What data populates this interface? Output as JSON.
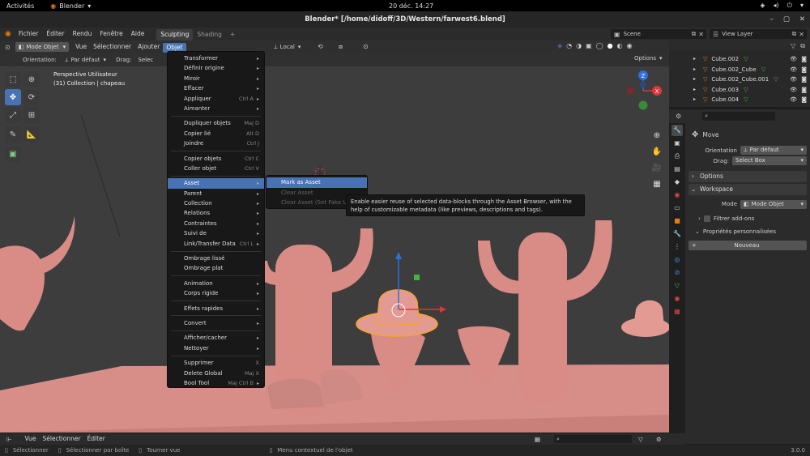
{
  "gnome": {
    "activities": "Activités",
    "app": "Blender",
    "clock": "20 déc.  14:27"
  },
  "window": {
    "title": "Blender* [/home/didoff/3D/Western/farwest6.blend]"
  },
  "topbar": {
    "menus": [
      "Fichier",
      "Éditer",
      "Rendu",
      "Fenêtre",
      "Aide"
    ],
    "workspaces": [
      "Sculpting",
      "Shading"
    ],
    "add_tab": "+",
    "scene": "Scene",
    "view_layer": "View Layer"
  },
  "viewport": {
    "mode": "Mode Objet",
    "menus": [
      "Vue",
      "Sélectionner",
      "Ajouter",
      "Objet"
    ],
    "transform": "Local",
    "orientation_label": "Orientation:",
    "orientation_value": "Par défaut",
    "drag_label": "Drag:",
    "drag_value": "Selec",
    "options": "Options",
    "overlay_title": "Perspective Utilisateur",
    "overlay_sub": "(31) Collection | chapeau",
    "gizmo_axes": [
      "X",
      "Y",
      "Z"
    ]
  },
  "object_menu": [
    {
      "label": "Transformer",
      "arrow": true
    },
    {
      "label": "Définir origine",
      "arrow": true
    },
    {
      "label": "Miroir",
      "arrow": true
    },
    {
      "label": "Effacer",
      "arrow": true
    },
    {
      "label": "Appliquer",
      "shortcut": "Ctrl A",
      "arrow": true
    },
    {
      "label": "Aimanter",
      "arrow": true
    },
    {
      "sep": true
    },
    {
      "label": "Dupliquer objets",
      "shortcut": "Maj D"
    },
    {
      "label": "Copier lié",
      "shortcut": "Alt D"
    },
    {
      "label": "Joindre",
      "shortcut": "Ctrl J"
    },
    {
      "sep": true
    },
    {
      "label": "Copier objets",
      "shortcut": "Ctrl C"
    },
    {
      "label": "Coller objet",
      "shortcut": "Ctrl V"
    },
    {
      "sep": true
    },
    {
      "label": "Asset",
      "arrow": true,
      "selected": true
    },
    {
      "label": "Parent",
      "arrow": true
    },
    {
      "label": "Collection",
      "arrow": true
    },
    {
      "label": "Relations",
      "arrow": true
    },
    {
      "label": "Contraintes",
      "arrow": true
    },
    {
      "label": "Suivi de",
      "arrow": true
    },
    {
      "label": "Link/Transfer Data",
      "shortcut": "Ctrl L",
      "arrow": true
    },
    {
      "sep": true
    },
    {
      "label": "Ombrage lissé"
    },
    {
      "label": "Ombrage plat"
    },
    {
      "sep": true
    },
    {
      "label": "Animation",
      "arrow": true
    },
    {
      "label": "Corps rigide",
      "arrow": true
    },
    {
      "sep": true
    },
    {
      "label": "Effets rapides",
      "arrow": true
    },
    {
      "sep": true
    },
    {
      "label": "Convert",
      "arrow": true
    },
    {
      "sep": true
    },
    {
      "label": "Afficher/cacher",
      "arrow": true
    },
    {
      "label": "Nettoyer",
      "arrow": true
    },
    {
      "sep": true
    },
    {
      "label": "Supprimer",
      "shortcut": "X"
    },
    {
      "label": "Delete Global",
      "shortcut": "Maj X"
    },
    {
      "label": "Bool Tool",
      "shortcut": "Maj Ctrl B",
      "arrow": true
    }
  ],
  "asset_submenu": [
    {
      "label": "Mark as Asset",
      "selected": true
    },
    {
      "label": "Clear Asset"
    },
    {
      "label": "Clear Asset (Set Fake U"
    }
  ],
  "tooltip": "Enable easier reuse of selected data-blocks through the Asset Browser, with the help of customizable metadata (like previews, descriptions and tags).",
  "outliner": {
    "rows": [
      "Cube.002",
      "Cube.002_Cube",
      "Cube.002_Cube.001",
      "Cube.003",
      "Cube.004"
    ]
  },
  "properties": {
    "tool_name": "Move",
    "orientation_label": "Orientation",
    "orientation_value": "Par défaut",
    "drag_label": "Drag:",
    "drag_value": "Select Box",
    "options_panel": "Options",
    "workspace_panel": "Workspace",
    "mode_label": "Mode",
    "mode_value": "Mode Objet",
    "filter_addons": "Filtrer add-ons",
    "custom_props": "Propriétés personnalisées",
    "new_button": "Nouveau"
  },
  "bottom_editor": {
    "menus": [
      "Vue",
      "Sélectionner",
      "Éditer"
    ]
  },
  "statusbar": {
    "items": [
      "Sélectionner",
      "Sélectionner par boîte",
      "Tourner vue",
      "Menu contextuel de l'objet"
    ],
    "version": "3.0.0"
  },
  "colors": {
    "accent": "#4772b3",
    "viewport_bg": "#3c3c3c",
    "floor": "#d98c87",
    "object": "#e39a93",
    "selection": "#f5a623"
  }
}
